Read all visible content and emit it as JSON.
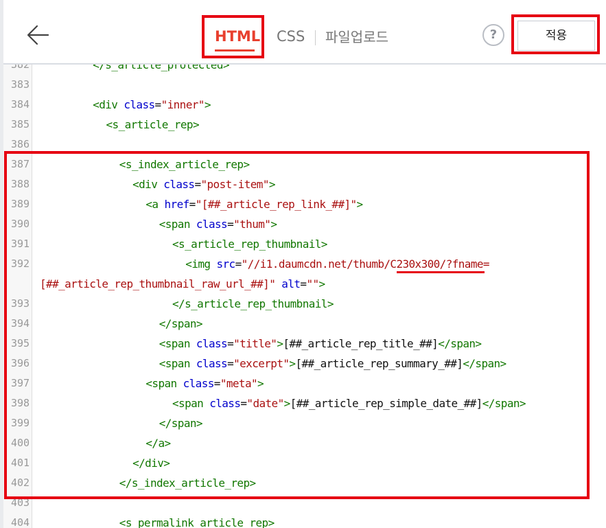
{
  "header": {
    "back_icon": "arrow-left-icon",
    "tabs": [
      {
        "label": "HTML",
        "active": true
      },
      {
        "label": "CSS",
        "active": false
      },
      {
        "label": "파일업로드",
        "active": false
      }
    ],
    "help_label": "?",
    "apply_label": "적용"
  },
  "colors": {
    "accent": "#e83f2e",
    "highlight": "#e60012",
    "tag": "#117700",
    "attr": "#0000cc",
    "string": "#aa1111"
  },
  "editor": {
    "lines": [
      {
        "num": "382",
        "indent": 8,
        "tokens": [
          [
            "tag",
            "</s_article_protected>"
          ]
        ]
      },
      {
        "num": "383",
        "indent": 0,
        "tokens": []
      },
      {
        "num": "384",
        "indent": 8,
        "tokens": [
          [
            "tag",
            "<div "
          ],
          [
            "attr",
            "class"
          ],
          [
            "plain",
            "="
          ],
          [
            "str",
            "\"inner\""
          ],
          [
            "tag",
            ">"
          ]
        ]
      },
      {
        "num": "385",
        "indent": 10,
        "tokens": [
          [
            "tag",
            "<s_article_rep>"
          ]
        ]
      },
      {
        "num": "386",
        "indent": 0,
        "tokens": []
      },
      {
        "num": "387",
        "indent": 12,
        "tokens": [
          [
            "tag",
            "<s_index_article_rep>"
          ]
        ]
      },
      {
        "num": "388",
        "indent": 14,
        "tokens": [
          [
            "tag",
            "<div "
          ],
          [
            "attr",
            "class"
          ],
          [
            "plain",
            "="
          ],
          [
            "str",
            "\"post-item\""
          ],
          [
            "tag",
            ">"
          ]
        ]
      },
      {
        "num": "389",
        "indent": 16,
        "tokens": [
          [
            "tag",
            "<a "
          ],
          [
            "attr",
            "href"
          ],
          [
            "plain",
            "="
          ],
          [
            "str",
            "\"[##_article_rep_link_##]\""
          ],
          [
            "tag",
            ">"
          ]
        ]
      },
      {
        "num": "390",
        "indent": 18,
        "tokens": [
          [
            "tag",
            "<span "
          ],
          [
            "attr",
            "class"
          ],
          [
            "plain",
            "="
          ],
          [
            "str",
            "\"thum\""
          ],
          [
            "tag",
            ">"
          ]
        ]
      },
      {
        "num": "391",
        "indent": 20,
        "tokens": [
          [
            "tag",
            "<s_article_rep_thumbnail>"
          ]
        ]
      },
      {
        "num": "392",
        "indent": 22,
        "tokens": [
          [
            "tag",
            "<img "
          ],
          [
            "attr",
            "src"
          ],
          [
            "plain",
            "="
          ],
          [
            "str",
            "\"//i1.daumcdn.net/thumb/C230x300/?fname="
          ]
        ]
      },
      {
        "num": "",
        "indent": 0,
        "tokens": [
          [
            "str",
            "[##_article_rep_thumbnail_raw_url_##]\""
          ],
          [
            "plain",
            " "
          ],
          [
            "attr",
            "alt"
          ],
          [
            "plain",
            "="
          ],
          [
            "str",
            "\"\""
          ],
          [
            "tag",
            ">"
          ]
        ]
      },
      {
        "num": "393",
        "indent": 20,
        "tokens": [
          [
            "tag",
            "</s_article_rep_thumbnail>"
          ]
        ]
      },
      {
        "num": "394",
        "indent": 18,
        "tokens": [
          [
            "tag",
            "</span>"
          ]
        ]
      },
      {
        "num": "395",
        "indent": 18,
        "tokens": [
          [
            "tag",
            "<span "
          ],
          [
            "attr",
            "class"
          ],
          [
            "plain",
            "="
          ],
          [
            "str",
            "\"title\""
          ],
          [
            "tag",
            ">"
          ],
          [
            "plain",
            "[##_article_rep_title_##]"
          ],
          [
            "tag",
            "</span>"
          ]
        ]
      },
      {
        "num": "396",
        "indent": 18,
        "tokens": [
          [
            "tag",
            "<span "
          ],
          [
            "attr",
            "class"
          ],
          [
            "plain",
            "="
          ],
          [
            "str",
            "\"excerpt\""
          ],
          [
            "tag",
            ">"
          ],
          [
            "plain",
            "[##_article_rep_summary_##]"
          ],
          [
            "tag",
            "</span>"
          ]
        ]
      },
      {
        "num": "397",
        "indent": 16,
        "tokens": [
          [
            "tag",
            "<span "
          ],
          [
            "attr",
            "class"
          ],
          [
            "plain",
            "="
          ],
          [
            "str",
            "\"meta\""
          ],
          [
            "tag",
            ">"
          ]
        ]
      },
      {
        "num": "398",
        "indent": 20,
        "tokens": [
          [
            "tag",
            "<span "
          ],
          [
            "attr",
            "class"
          ],
          [
            "plain",
            "="
          ],
          [
            "str",
            "\"date\""
          ],
          [
            "tag",
            ">"
          ],
          [
            "plain",
            "[##_article_rep_simple_date_##]"
          ],
          [
            "tag",
            "</span>"
          ]
        ]
      },
      {
        "num": "399",
        "indent": 18,
        "tokens": [
          [
            "tag",
            "</span>"
          ]
        ]
      },
      {
        "num": "400",
        "indent": 16,
        "tokens": [
          [
            "tag",
            "</a>"
          ]
        ]
      },
      {
        "num": "401",
        "indent": 14,
        "tokens": [
          [
            "tag",
            "</div>"
          ]
        ]
      },
      {
        "num": "402",
        "indent": 12,
        "tokens": [
          [
            "tag",
            "</s_index_article_rep>"
          ]
        ]
      },
      {
        "num": "403",
        "indent": 0,
        "tokens": []
      },
      {
        "num": "404",
        "indent": 12,
        "tokens": [
          [
            "tag",
            "<s_permalink_article_rep>"
          ]
        ]
      }
    ]
  }
}
